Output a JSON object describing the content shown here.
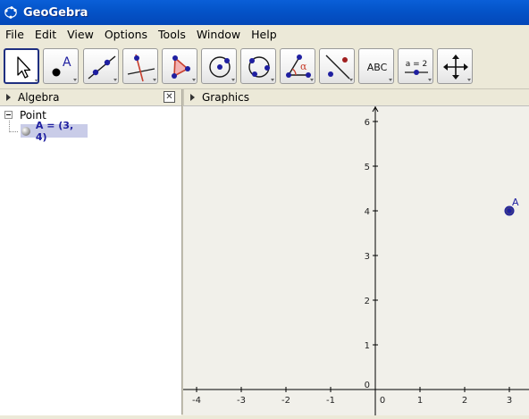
{
  "window": {
    "title": "GeoGebra"
  },
  "menu": [
    "File",
    "Edit",
    "View",
    "Options",
    "Tools",
    "Window",
    "Help"
  ],
  "toolbar": {
    "tools": [
      {
        "name": "move-tool",
        "icon": "arrow-cursor-icon"
      },
      {
        "name": "point-tool",
        "icon": "point-icon",
        "label": "A"
      },
      {
        "name": "line-tool",
        "icon": "line-through-points-icon"
      },
      {
        "name": "perpendicular-tool",
        "icon": "perpendicular-line-icon"
      },
      {
        "name": "polygon-tool",
        "icon": "polygon-icon"
      },
      {
        "name": "circle-tool",
        "icon": "circle-center-point-icon"
      },
      {
        "name": "circle-three-points-tool",
        "icon": "circle-three-points-icon"
      },
      {
        "name": "angle-tool",
        "icon": "angle-icon",
        "label": "α"
      },
      {
        "name": "reflect-tool",
        "icon": "reflect-about-line-icon"
      },
      {
        "name": "text-tool",
        "icon": "text-icon",
        "label": "ABC"
      },
      {
        "name": "slider-tool",
        "icon": "slider-icon",
        "label": "a = 2"
      },
      {
        "name": "move-view-tool",
        "icon": "move-graphics-view-icon"
      }
    ]
  },
  "algebra": {
    "title": "Algebra",
    "folder": "Point",
    "items": [
      {
        "text": "A = (3, 4)"
      }
    ]
  },
  "graphics": {
    "title": "Graphics",
    "x_ticks": [
      -4,
      -3,
      -2,
      -1,
      0,
      1,
      2,
      3
    ],
    "y_ticks": [
      1,
      2,
      3,
      4,
      5,
      6
    ],
    "points": [
      {
        "label": "A",
        "x": 3,
        "y": 4
      }
    ]
  },
  "colors": {
    "point": "#1f1fa0",
    "title_bar": "#0453c8",
    "selection": "#c9cce8"
  }
}
